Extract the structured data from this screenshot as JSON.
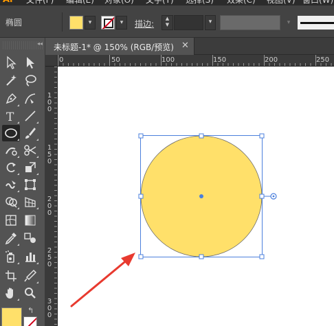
{
  "menubar": {
    "logo": "Ai",
    "items": [
      "文件(F)",
      "编辑(E)",
      "对象(O)",
      "文字(T)",
      "选择(S)",
      "效果(C)",
      "视图(V)",
      "窗口(W)"
    ]
  },
  "control_bar": {
    "shape_label": "椭圆",
    "stroke_label": "描边",
    "stroke_colon": ":",
    "colors": {
      "fill": "#ffe06a",
      "stroke_none": "#d0021b"
    }
  },
  "tab": {
    "title": "未标题-1* @ 150% (RGB/预览)",
    "close": "✕"
  },
  "rulers": {
    "horizontal": [
      "0",
      "50",
      "100",
      "150",
      "200",
      "250"
    ],
    "vertical": [
      "100",
      "150",
      "200",
      "250",
      "300"
    ]
  },
  "tools": [
    "selection-tool",
    "direct-selection-tool",
    "magic-wand-tool",
    "lasso-tool",
    "pen-tool",
    "curvature-tool",
    "type-tool",
    "line-segment-tool",
    "ellipse-tool",
    "paintbrush-tool",
    "shaper-tool",
    "scissors-tool",
    "rotate-tool",
    "scale-tool",
    "warp-tool",
    "free-transform-tool",
    "shape-builder-tool",
    "perspective-grid-tool",
    "mesh-tool",
    "gradient-tool",
    "eyedropper-tool",
    "blend-tool",
    "symbol-sprayer-tool",
    "column-graph-tool",
    "artboard-tool",
    "slice-tool",
    "hand-tool",
    "zoom-tool"
  ],
  "canvas": {
    "circle_fill": "#ffe06a",
    "circle_stroke": "#6b6b6b",
    "selection_color": "#4a7fdc",
    "arrow_color": "#e83a2f"
  }
}
